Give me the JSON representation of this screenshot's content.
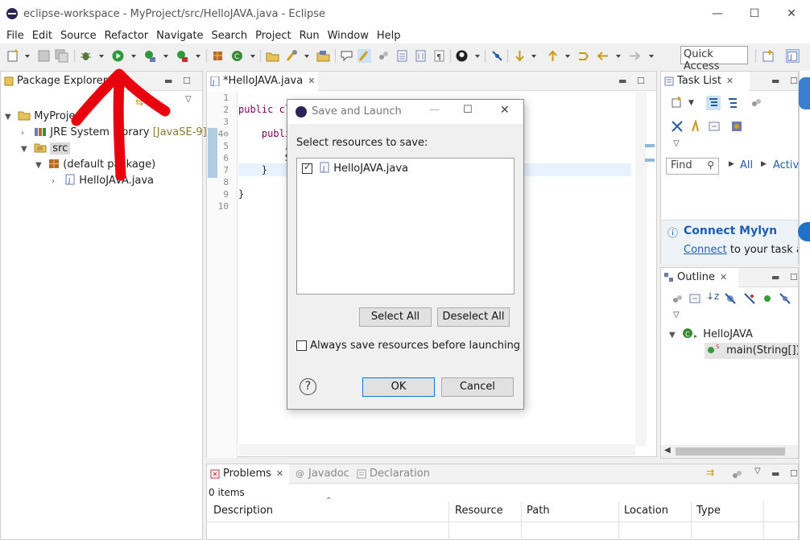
{
  "window": {
    "title": "eclipse-workspace - MyProject/src/HelloJAVA.java - Eclipse",
    "controls": [
      "—",
      "☐",
      "✕"
    ]
  },
  "menu": [
    "File",
    "Edit",
    "Source",
    "Refactor",
    "Navigate",
    "Search",
    "Project",
    "Run",
    "Window",
    "Help"
  ],
  "toolbar": {
    "quick_access": "Quick Access"
  },
  "package_explorer": {
    "tab": "Package Explorer",
    "tree": [
      {
        "label": "MyProje",
        "suffix": ""
      },
      {
        "label": "JRE System Library ",
        "suffix": "[JavaSE-9]"
      },
      {
        "label": "src",
        "suffix": ""
      },
      {
        "label": "(default package)",
        "suffix": ""
      },
      {
        "label": "HelloJAVA.java",
        "suffix": ""
      }
    ]
  },
  "editor": {
    "tab": "*HelloJAVA.java",
    "line_numbers": [
      "1",
      "2",
      "3",
      "4⊖",
      "5",
      "6",
      "7",
      "8",
      "9",
      "10"
    ],
    "lines": [
      "",
      "public cl",
      "",
      "    publi",
      "        /",
      "        S",
      "    }",
      "",
      "}",
      ""
    ]
  },
  "task_list": {
    "tab": "Task List",
    "find_placeholder": "Find",
    "filter_all": "All",
    "filter_activ": "Activ...",
    "mylyn_title": "Connect Mylyn",
    "mylyn_link": "Connect",
    "mylyn_text": " to your task an"
  },
  "outline": {
    "tab": "Outline",
    "class_name": "HelloJAVA",
    "method": "main(String[]) :"
  },
  "problems": {
    "tabs": [
      "Problems",
      "Javadoc",
      "Declaration"
    ],
    "count": "0 items",
    "columns": [
      "Description",
      "Resource",
      "Path",
      "Location",
      "Type"
    ]
  },
  "dialog": {
    "title": "Save and Launch",
    "prompt": "Select resources to save:",
    "resources": [
      {
        "name": "HelloJAVA.java",
        "checked": true
      }
    ],
    "select_all": "Select All",
    "deselect_all": "Deselect All",
    "always_save": "Always save resources before launching",
    "help": "?",
    "ok": "OK",
    "cancel": "Cancel"
  },
  "colors": {
    "annotation_red": "#e8000f",
    "link_blue": "#1c5fb0",
    "library_tag": "#8a7a30"
  }
}
